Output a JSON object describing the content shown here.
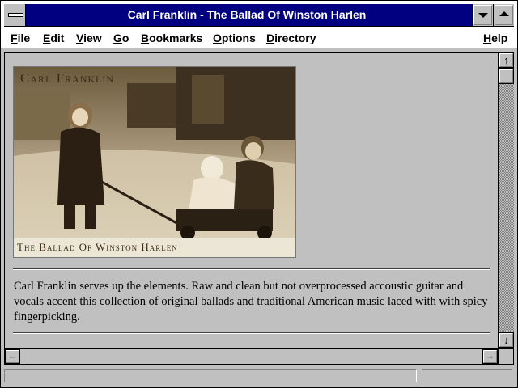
{
  "window": {
    "title": "Carl Franklin - The Ballad Of Winston Harlen"
  },
  "menu": {
    "items": [
      {
        "label": "File"
      },
      {
        "label": "Edit"
      },
      {
        "label": "View"
      },
      {
        "label": "Go"
      },
      {
        "label": "Bookmarks"
      },
      {
        "label": "Options"
      },
      {
        "label": "Directory"
      }
    ],
    "help": "Help"
  },
  "page": {
    "image": {
      "title": "Carl Franklin",
      "caption": "The Ballad Of Winston Harlen",
      "description_tone": "sepia photo of three children outdoors"
    },
    "description": "Carl Franklin serves up the elements. Raw and clean but not overprocessed accoustic guitar and vocals accent this collection of original ballads and traditional American music laced with with spicy fingerpicking."
  },
  "status": {
    "text": ""
  },
  "colors": {
    "titlebar": "#000080",
    "face": "#c0c0c0",
    "sepia": "#3b2a14"
  },
  "icons": {
    "sysmenu": "system-menu-icon",
    "minimize": "minimize-arrow-icon",
    "maximize": "maximize-arrow-icon",
    "scroll_up": "up-arrow-icon",
    "scroll_down": "down-arrow-icon",
    "scroll_left": "left-arrow-icon",
    "scroll_right": "right-arrow-icon"
  }
}
